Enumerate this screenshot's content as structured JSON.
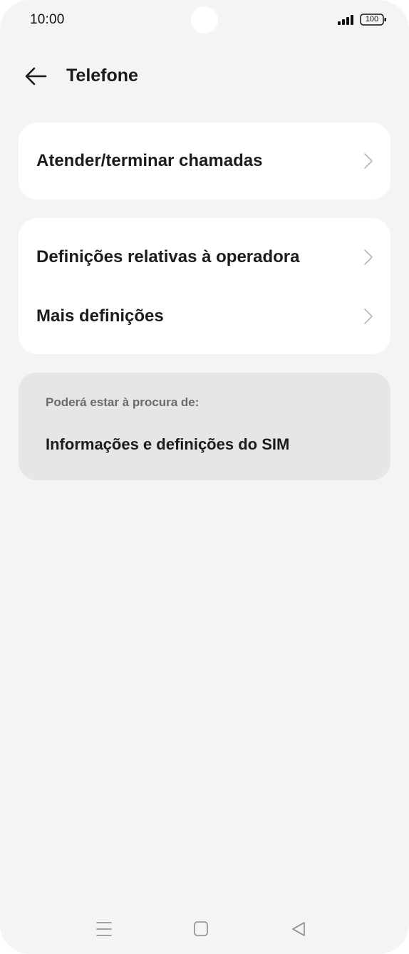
{
  "status_bar": {
    "time": "10:00",
    "battery": "100",
    "icons": [
      "signal-icon",
      "battery-icon"
    ]
  },
  "header": {
    "back_icon": "arrow-left-icon",
    "title": "Telefone"
  },
  "settings_groups": [
    {
      "items": [
        {
          "label": "Atender/terminar chamadas",
          "icon": "chevron-right-icon"
        }
      ]
    },
    {
      "items": [
        {
          "label": "Definições relativas à operadora",
          "icon": "chevron-right-icon"
        },
        {
          "label": "Mais definições",
          "icon": "chevron-right-icon"
        }
      ]
    }
  ],
  "suggestions": {
    "heading": "Poderá estar à procura de:",
    "items": [
      {
        "label": "Informações e definições do SIM"
      }
    ]
  },
  "nav_bar": {
    "icons": [
      "menu-icon",
      "home-icon",
      "back-triangle-icon"
    ]
  },
  "colors": {
    "background": "#f4f4f4",
    "card": "#ffffff",
    "suggestion_card": "#e6e6e6",
    "text": "#1c1c1c",
    "muted_text": "#6a6a6a",
    "chevron": "#b5b5b5"
  }
}
